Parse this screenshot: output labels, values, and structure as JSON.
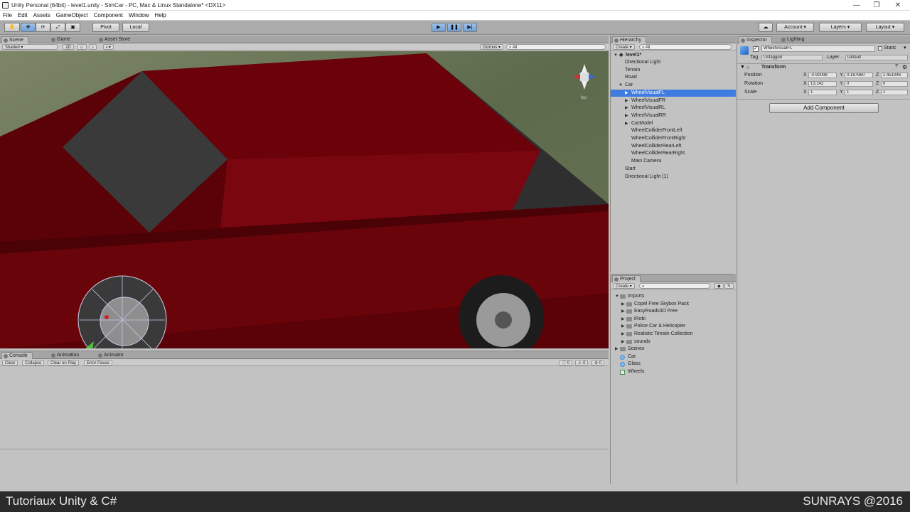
{
  "window": {
    "title": "Unity Personal (64bit) - level1.unity - SimCar - PC, Mac & Linux Standalone* <DX11>",
    "min": "—",
    "max": "❐",
    "close": "✕"
  },
  "menu": [
    "File",
    "Edit",
    "Assets",
    "GameObject",
    "Component",
    "Window",
    "Help"
  ],
  "toolbar": {
    "pivot": "Pivot",
    "local": "Local",
    "account": "Account",
    "layers": "Layers",
    "layout": "Layout"
  },
  "scene": {
    "tabs": [
      "Scene",
      "Game",
      "Asset Store"
    ],
    "shading": "Shaded",
    "mode2d": "2D",
    "gizmos": "Gizmos",
    "search_placeholder": "All",
    "iso": "Iso"
  },
  "hierarchy": {
    "tab": "Hierarchy",
    "create": "Create",
    "search_placeholder": "All",
    "scene": "level1*",
    "items": [
      {
        "label": "Directional Light",
        "indent": 0
      },
      {
        "label": "Terrain",
        "indent": 0
      },
      {
        "label": "Road",
        "indent": 0
      },
      {
        "label": "Car",
        "indent": 0,
        "expanded": true
      },
      {
        "label": "WheelVisualFL",
        "indent": 1,
        "selected": true,
        "arrow": true
      },
      {
        "label": "WheelVisualFR",
        "indent": 1,
        "arrow": true
      },
      {
        "label": "WheelVisualRL",
        "indent": 1,
        "arrow": true
      },
      {
        "label": "WheelVisualRR",
        "indent": 1,
        "arrow": true
      },
      {
        "label": "CarModel",
        "indent": 1,
        "arrow": true
      },
      {
        "label": "WheelColliderFrontLeft",
        "indent": 1
      },
      {
        "label": "WheelColliderFrontRight",
        "indent": 1
      },
      {
        "label": "WheelColliderRearLeft",
        "indent": 1
      },
      {
        "label": "WheelColliderRearRight",
        "indent": 1
      },
      {
        "label": "Main Camera",
        "indent": 1
      },
      {
        "label": "Start",
        "indent": 0
      },
      {
        "label": "Directional Light (1)",
        "indent": 0
      }
    ]
  },
  "inspector": {
    "tabs": [
      "Inspector",
      "Lighting"
    ],
    "name": "WheelVisualFL",
    "static": "Static",
    "tag_label": "Tag",
    "tag": "Untagged",
    "layer_label": "Layer",
    "layer": "Default",
    "transform": {
      "title": "Transform",
      "position_label": "Position",
      "rotation_label": "Rotation",
      "scale_label": "Scale",
      "position": {
        "x": "-0.90098",
        "y": "0.187960",
        "z": "1.451046"
      },
      "rotation": {
        "x": "13.142",
        "y": "0",
        "z": "0"
      },
      "scale": {
        "x": "1",
        "y": "1",
        "z": "1"
      }
    },
    "add_component": "Add Component"
  },
  "project": {
    "tab": "Project",
    "create": "Create",
    "items": [
      {
        "label": "Imports",
        "indent": 0,
        "type": "folder",
        "expanded": true
      },
      {
        "label": "Copel Free Skybox Pack",
        "indent": 1,
        "type": "folder"
      },
      {
        "label": "EasyRoads3D Free",
        "indent": 1,
        "type": "folder"
      },
      {
        "label": "iRobi",
        "indent": 1,
        "type": "folder"
      },
      {
        "label": "Police Car & Helicopter",
        "indent": 1,
        "type": "folder"
      },
      {
        "label": "Realistic Terrain Collection",
        "indent": 1,
        "type": "folder"
      },
      {
        "label": "sounds",
        "indent": 1,
        "type": "folder"
      },
      {
        "label": "Scenes",
        "indent": 0,
        "type": "folder"
      },
      {
        "label": "Car",
        "indent": 0,
        "type": "asset"
      },
      {
        "label": "Glass",
        "indent": 0,
        "type": "asset"
      },
      {
        "label": "Wheels",
        "indent": 0,
        "type": "script"
      }
    ]
  },
  "console": {
    "tabs": [
      "Console",
      "Animation",
      "Animator"
    ],
    "buttons": [
      "Clear",
      "Collapse",
      "Clear on Play",
      "Error Pause"
    ],
    "counts": [
      "0",
      "0",
      "0"
    ]
  },
  "watermark": {
    "left": "Tutoriaux Unity & C#",
    "right": "SUNRAYS @2016"
  },
  "colors": {
    "selection": "#3e7ce0",
    "car_body": "#6a0208",
    "play_blue": "#5b8ed6"
  }
}
